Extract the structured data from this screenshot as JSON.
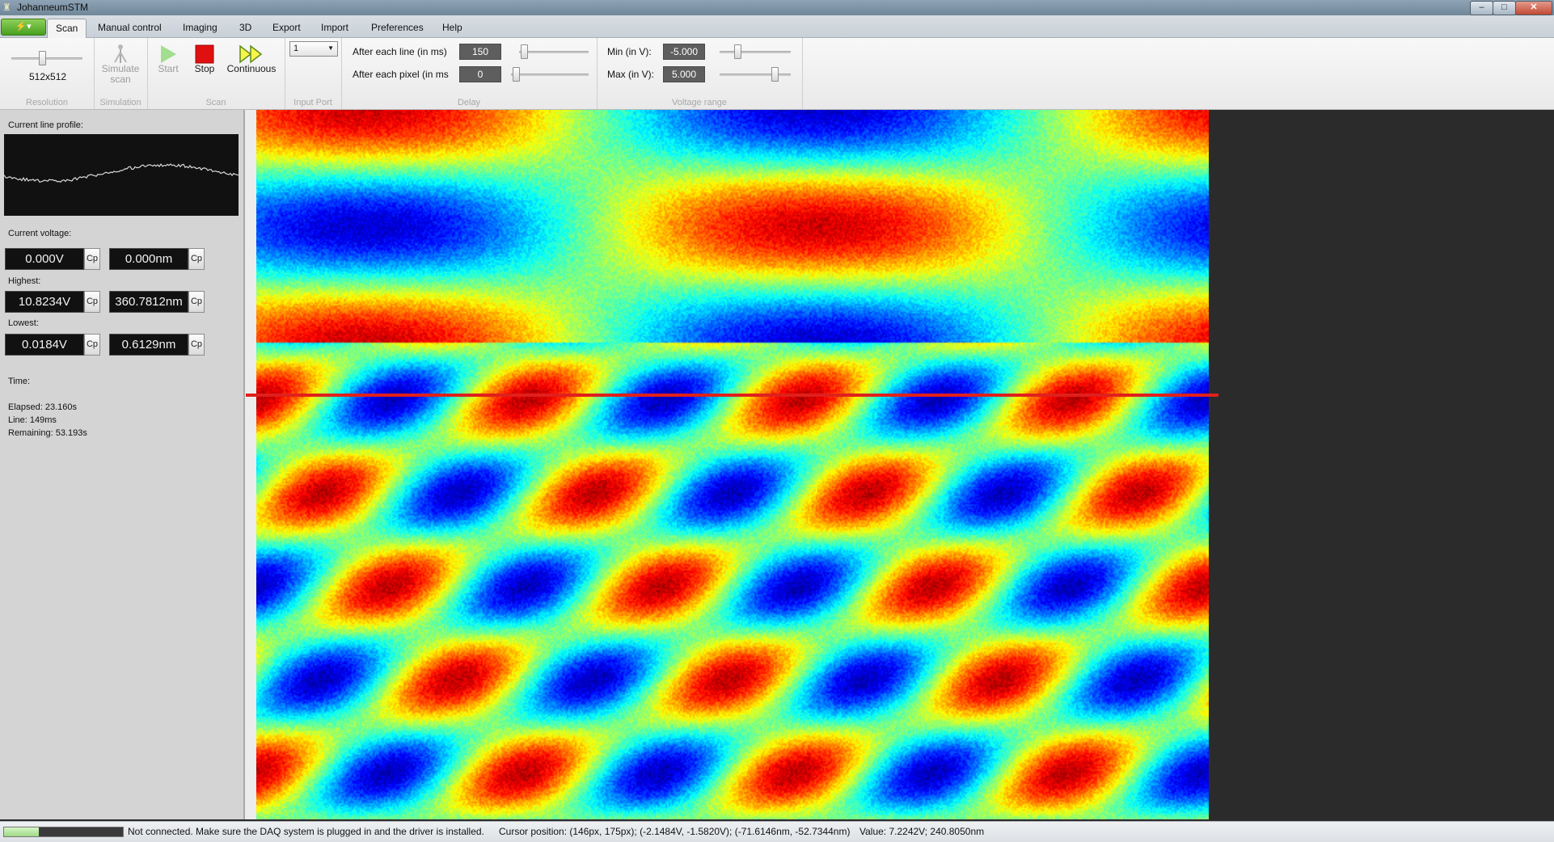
{
  "window": {
    "title": "JohanneumSTM",
    "minimize": "–",
    "maximize": "□",
    "close": "✕"
  },
  "menu": {
    "app_button": "⚡▾",
    "tabs": [
      "Scan",
      "Manual control",
      "Imaging",
      "3D",
      "Export",
      "Import",
      "Preferences",
      "Help"
    ]
  },
  "ribbon": {
    "resolution": {
      "value": "512x512",
      "label": "Resolution"
    },
    "simulation": {
      "button": "Simulate scan",
      "label": "Simulation"
    },
    "scan": {
      "start": "Start",
      "stop": "Stop",
      "continuous": "Continuous",
      "label": "Scan"
    },
    "input_port": {
      "value": "1",
      "label": "Input Port"
    },
    "delay": {
      "line_label": "After each line (in ms)",
      "line_value": "150",
      "pixel_label": "After each pixel (in ms",
      "pixel_value": "0",
      "label": "Delay"
    },
    "voltage_range": {
      "min_label": "Min (in V):",
      "min_value": "-5.000",
      "max_label": "Max (in V):",
      "max_value": "5.000",
      "label": "Voltage range"
    }
  },
  "left_panel": {
    "line_profile_label": "Current line profile:",
    "current_voltage_label": "Current voltage:",
    "current_v": "0.000V",
    "current_nm": "0.000nm",
    "highest_label": "Highest:",
    "highest_v": "10.8234V",
    "highest_nm": "360.7812nm",
    "lowest_label": "Lowest:",
    "lowest_v": "0.0184V",
    "lowest_nm": "0.6129nm",
    "copy_label": "Cp",
    "time_label": "Time:",
    "elapsed": "Elapsed: 23.160s",
    "line": "Line: 149ms",
    "remaining": "Remaining: 53.193s"
  },
  "status": {
    "progress": 0.29,
    "message": "Not connected. Make sure the DAQ system is plugged in and the driver is installed.",
    "cursor": "Cursor position: (146px, 175px);  (-2.1484V, -1.5820V);  (-71.6146nm, -52.7344nm)",
    "value": "Value: 7.2242V; 240.8050nm"
  },
  "colors": {
    "scan_line": "#e0201c",
    "status_green": "#9ed987",
    "stop_red": "#e01010",
    "start_green": "#5ccc3a"
  }
}
